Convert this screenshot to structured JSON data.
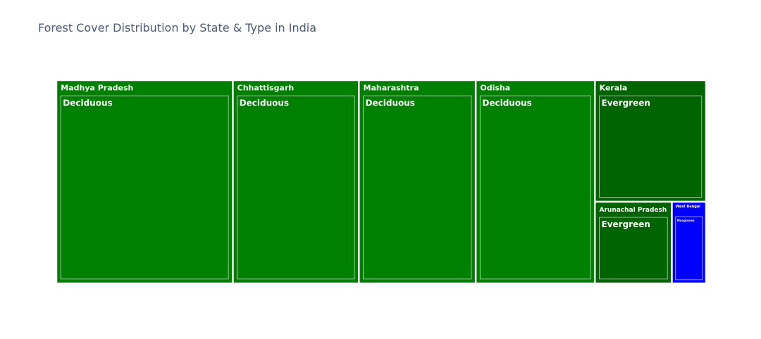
{
  "chart_data": {
    "type": "treemap",
    "title": "Forest Cover Distribution by State & Type in India",
    "nodes": [
      {
        "state": "Madhya Pradesh",
        "type": "Deciduous",
        "value": 77
      },
      {
        "state": "Chhattisgarh",
        "type": "Deciduous",
        "value": 55
      },
      {
        "state": "Maharashtra",
        "type": "Deciduous",
        "value": 51
      },
      {
        "state": "Odisha",
        "type": "Deciduous",
        "value": 52
      },
      {
        "state": "Kerala",
        "type": "Evergreen",
        "value": 29
      },
      {
        "state": "Arunachal Pradesh",
        "type": "Evergreen",
        "value": 13.5
      },
      {
        "state": "West Bengal",
        "type": "Mangroves",
        "value": 6
      }
    ],
    "colors": {
      "Deciduous": "#008000",
      "Evergreen": "#006400",
      "Mangroves": "#0000ff"
    }
  }
}
